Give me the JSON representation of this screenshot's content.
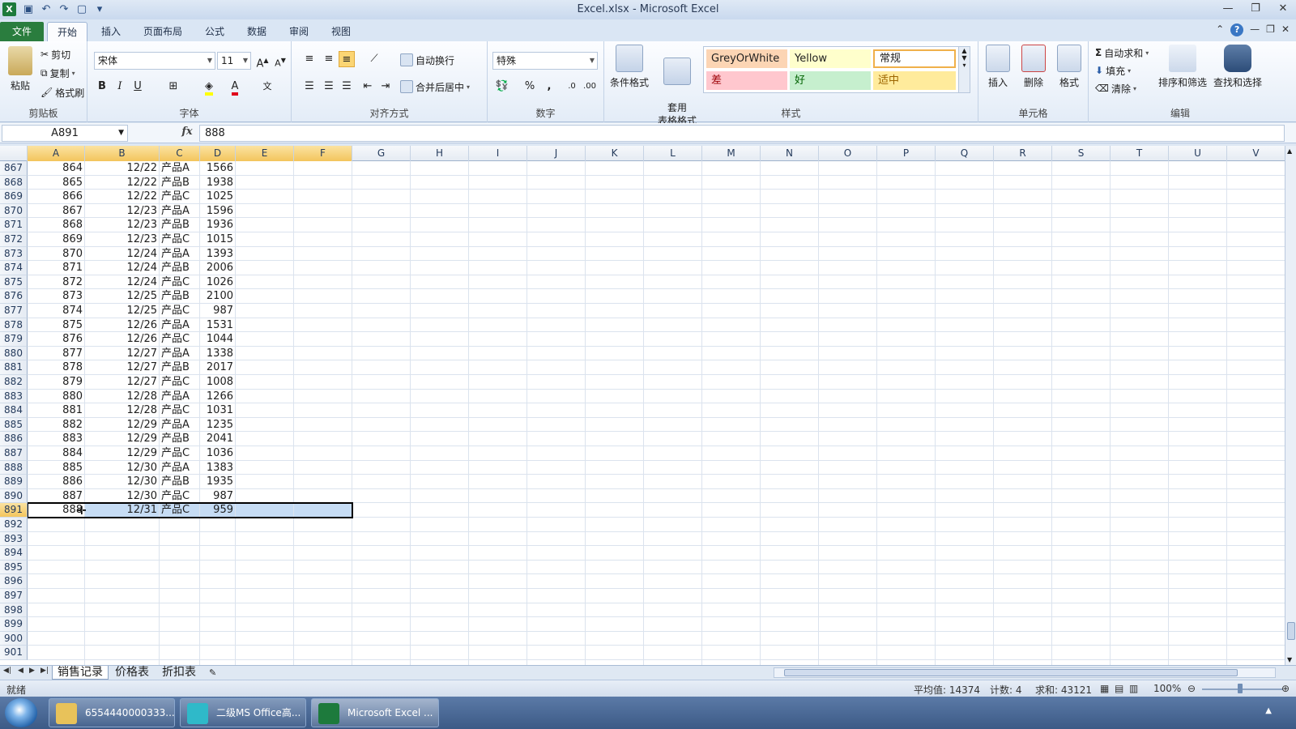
{
  "window": {
    "title": "Excel.xlsx - Microsoft Excel"
  },
  "ribbon_tabs": [
    "文件",
    "开始",
    "插入",
    "页面布局",
    "公式",
    "数据",
    "审阅",
    "视图"
  ],
  "clipboard": {
    "paste": "粘贴",
    "cut": "剪切",
    "copy": "复制",
    "format_painter": "格式刷",
    "label": "剪贴板"
  },
  "font": {
    "name": "宋体",
    "size": "11",
    "label": "字体"
  },
  "alignment": {
    "wrap": "自动换行",
    "merge": "合并后居中",
    "label": "对齐方式"
  },
  "number": {
    "format": "特殊",
    "label": "数字"
  },
  "styles": {
    "conditional": "条件格式",
    "table_format": "套用\n表格格式",
    "label": "样式",
    "cells": [
      {
        "text": "GreyOrWhite",
        "bg": "#fcd5b4",
        "color": "#1e1e1e"
      },
      {
        "text": "Yellow",
        "bg": "#ffffcc",
        "color": "#1e1e1e"
      },
      {
        "text": "常规",
        "bg": "#ffffff",
        "color": "#1e1e1e"
      },
      {
        "text": "差",
        "bg": "#ffc7ce",
        "color": "#9c0006"
      },
      {
        "text": "好",
        "bg": "#c6efce",
        "color": "#006100"
      },
      {
        "text": "适中",
        "bg": "#ffeb9c",
        "color": "#9c6500"
      }
    ]
  },
  "cells_group": {
    "insert": "插入",
    "delete": "删除",
    "format": "格式",
    "label": "单元格"
  },
  "editing": {
    "autosum": "自动求和",
    "fill": "填充",
    "clear": "清除",
    "sort": "排序和筛选",
    "find": "查找和选择",
    "label": "编辑"
  },
  "formula_bar": {
    "name_box": "A891",
    "fx": "fx",
    "value": "888"
  },
  "columns": [
    "A",
    "B",
    "C",
    "D",
    "E",
    "F",
    "G",
    "H",
    "I",
    "J",
    "K",
    "L",
    "M",
    "N",
    "O",
    "P",
    "Q",
    "R",
    "S",
    "T",
    "U",
    "V"
  ],
  "rows": [
    {
      "n": "867",
      "a": "864",
      "b": "12/22",
      "c": "产品A",
      "d": "1566"
    },
    {
      "n": "868",
      "a": "865",
      "b": "12/22",
      "c": "产品B",
      "d": "1938"
    },
    {
      "n": "869",
      "a": "866",
      "b": "12/22",
      "c": "产品C",
      "d": "1025"
    },
    {
      "n": "870",
      "a": "867",
      "b": "12/23",
      "c": "产品A",
      "d": "1596"
    },
    {
      "n": "871",
      "a": "868",
      "b": "12/23",
      "c": "产品B",
      "d": "1936"
    },
    {
      "n": "872",
      "a": "869",
      "b": "12/23",
      "c": "产品C",
      "d": "1015"
    },
    {
      "n": "873",
      "a": "870",
      "b": "12/24",
      "c": "产品A",
      "d": "1393"
    },
    {
      "n": "874",
      "a": "871",
      "b": "12/24",
      "c": "产品B",
      "d": "2006"
    },
    {
      "n": "875",
      "a": "872",
      "b": "12/24",
      "c": "产品C",
      "d": "1026"
    },
    {
      "n": "876",
      "a": "873",
      "b": "12/25",
      "c": "产品B",
      "d": "2100"
    },
    {
      "n": "877",
      "a": "874",
      "b": "12/25",
      "c": "产品C",
      "d": "987"
    },
    {
      "n": "878",
      "a": "875",
      "b": "12/26",
      "c": "产品A",
      "d": "1531"
    },
    {
      "n": "879",
      "a": "876",
      "b": "12/26",
      "c": "产品C",
      "d": "1044"
    },
    {
      "n": "880",
      "a": "877",
      "b": "12/27",
      "c": "产品A",
      "d": "1338"
    },
    {
      "n": "881",
      "a": "878",
      "b": "12/27",
      "c": "产品B",
      "d": "2017"
    },
    {
      "n": "882",
      "a": "879",
      "b": "12/27",
      "c": "产品C",
      "d": "1008"
    },
    {
      "n": "883",
      "a": "880",
      "b": "12/28",
      "c": "产品A",
      "d": "1266"
    },
    {
      "n": "884",
      "a": "881",
      "b": "12/28",
      "c": "产品C",
      "d": "1031"
    },
    {
      "n": "885",
      "a": "882",
      "b": "12/29",
      "c": "产品A",
      "d": "1235"
    },
    {
      "n": "886",
      "a": "883",
      "b": "12/29",
      "c": "产品B",
      "d": "2041"
    },
    {
      "n": "887",
      "a": "884",
      "b": "12/29",
      "c": "产品C",
      "d": "1036"
    },
    {
      "n": "888",
      "a": "885",
      "b": "12/30",
      "c": "产品A",
      "d": "1383"
    },
    {
      "n": "889",
      "a": "886",
      "b": "12/30",
      "c": "产品B",
      "d": "1935"
    },
    {
      "n": "890",
      "a": "887",
      "b": "12/30",
      "c": "产品C",
      "d": "987"
    },
    {
      "n": "891",
      "a": "888",
      "b": "12/31",
      "c": "产品C",
      "d": "959"
    },
    {
      "n": "892",
      "a": "",
      "b": "",
      "c": "",
      "d": ""
    },
    {
      "n": "893",
      "a": "",
      "b": "",
      "c": "",
      "d": ""
    },
    {
      "n": "894",
      "a": "",
      "b": "",
      "c": "",
      "d": ""
    },
    {
      "n": "895",
      "a": "",
      "b": "",
      "c": "",
      "d": ""
    },
    {
      "n": "896",
      "a": "",
      "b": "",
      "c": "",
      "d": ""
    },
    {
      "n": "897",
      "a": "",
      "b": "",
      "c": "",
      "d": ""
    },
    {
      "n": "898",
      "a": "",
      "b": "",
      "c": "",
      "d": ""
    },
    {
      "n": "899",
      "a": "",
      "b": "",
      "c": "",
      "d": ""
    },
    {
      "n": "900",
      "a": "",
      "b": "",
      "c": "",
      "d": ""
    },
    {
      "n": "901",
      "a": "",
      "b": "",
      "c": "",
      "d": ""
    }
  ],
  "selected_row": "891",
  "sheet_tabs": [
    "销售记录",
    "价格表",
    "折扣表"
  ],
  "status": {
    "ready": "就绪",
    "average": "平均值: 14374",
    "count": "计数: 4",
    "sum": "求和: 43121",
    "zoom": "100%"
  },
  "taskbar": [
    {
      "label": "6554440000333...",
      "color": "#e8c25a"
    },
    {
      "label": "二级MS Office高...",
      "color": "#2fb9c9"
    },
    {
      "label": "Microsoft Excel ...",
      "color": "#1d7a3c"
    }
  ],
  "colors": {
    "accent": "#2a7d3e",
    "selection": "#c6dcf4",
    "header_selected": "#f3c55d"
  }
}
